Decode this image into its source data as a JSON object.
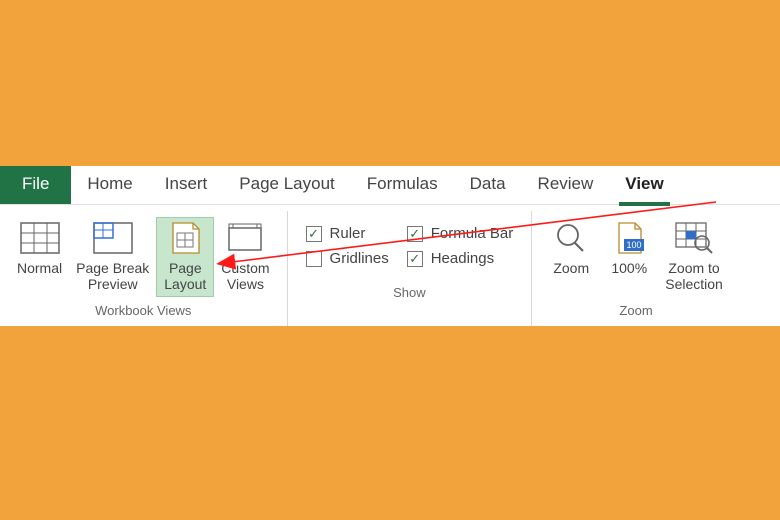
{
  "tabs": {
    "file": "File",
    "home": "Home",
    "insert": "Insert",
    "page_layout": "Page Layout",
    "formulas": "Formulas",
    "data": "Data",
    "review": "Review",
    "view": "View",
    "active": "view"
  },
  "groups": {
    "workbook_views": {
      "title": "Workbook Views",
      "buttons": {
        "normal": "Normal",
        "page_break": "Page Break\nPreview",
        "page_layout": "Page\nLayout",
        "custom_views": "Custom\nViews"
      },
      "highlighted": "page_layout"
    },
    "show": {
      "title": "Show",
      "ruler": {
        "label": "Ruler",
        "checked": true
      },
      "formula_bar": {
        "label": "Formula Bar",
        "checked": true
      },
      "gridlines": {
        "label": "Gridlines",
        "checked": false
      },
      "headings": {
        "label": "Headings",
        "checked": true
      }
    },
    "zoom": {
      "title": "Zoom",
      "zoom": "Zoom",
      "hundred": "100%",
      "zoom_to_selection": "Zoom to\nSelection"
    }
  },
  "colors": {
    "excel_green": "#217346",
    "highlight": "#c7e6cd",
    "background": "#f2a33c"
  },
  "annotation": {
    "arrow_from": "tab-view",
    "arrow_to": "page-layout-button"
  }
}
